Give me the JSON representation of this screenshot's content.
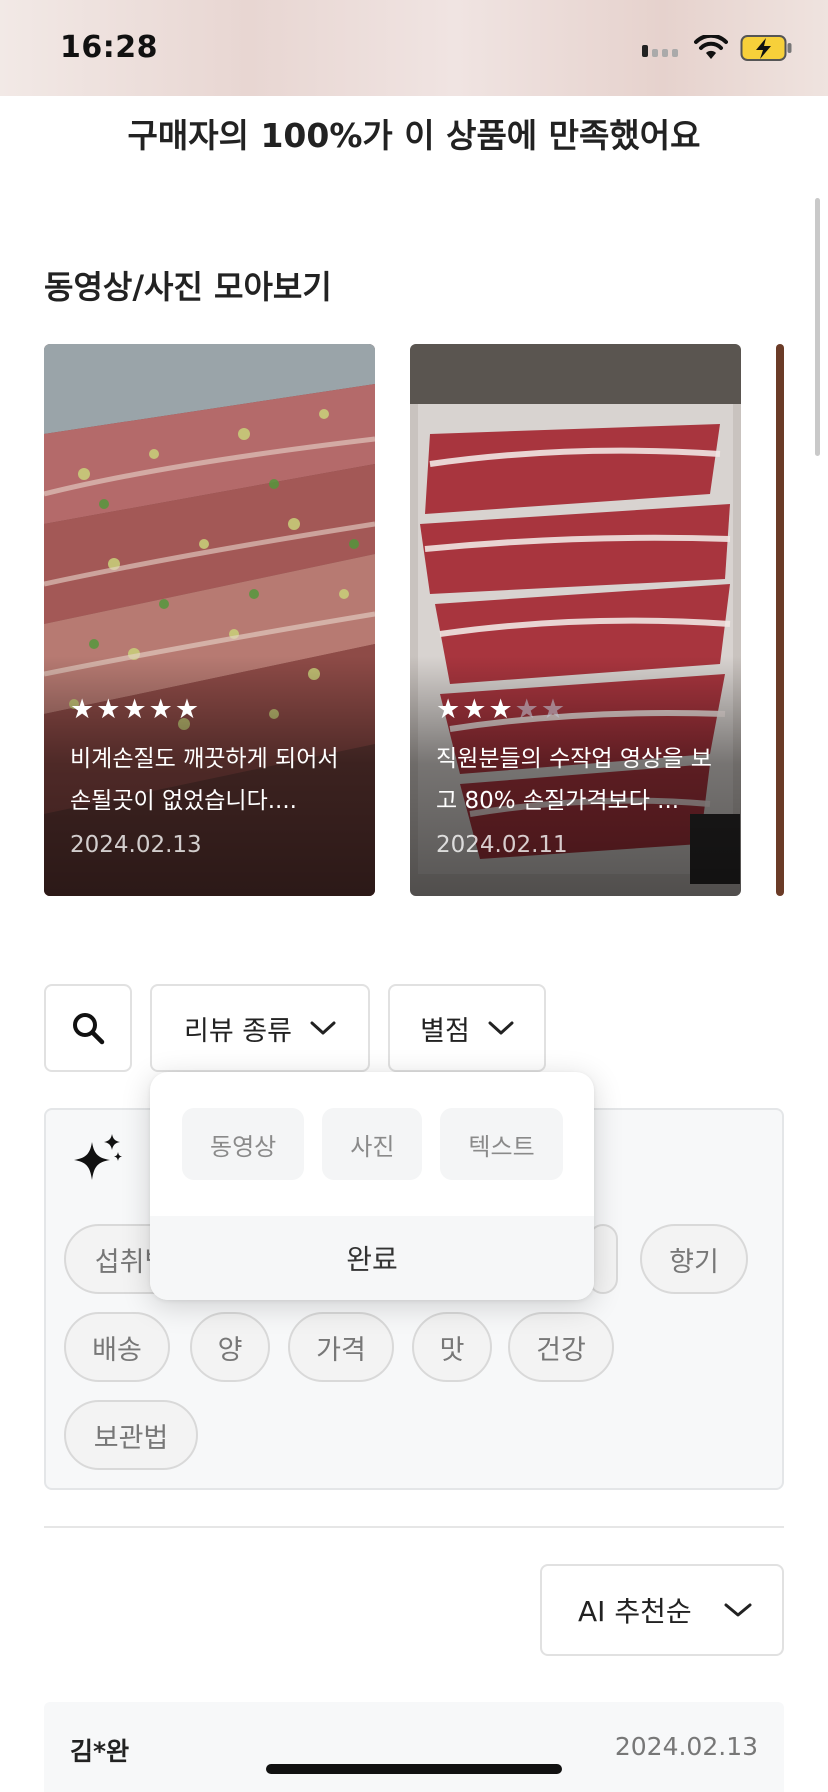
{
  "status_bar": {
    "time": "16:28"
  },
  "banner": {
    "text": "구매자의 100%가 이 상품에 만족했어요"
  },
  "gallery": {
    "title": "동영상/사진 모아보기",
    "cards": [
      {
        "rating": 5,
        "text": "비계손질도 깨끗하게 되어서 손될곳이 없었습니다....",
        "date": "2024.02.13"
      },
      {
        "rating": 3,
        "text": "직원분들의 수작업 영상을 보고 80% 손질가격보다 ...",
        "date": "2024.02.11"
      }
    ]
  },
  "filters": {
    "search_icon": "search-icon",
    "review_type_label": "리뷰 종류",
    "rating_label": "별점"
  },
  "review_type_popover": {
    "options": [
      "동영상",
      "사진",
      "텍스트"
    ],
    "done_label": "완료"
  },
  "keywords": {
    "icon": "sparkle-icon",
    "chips": [
      "섭취법",
      "향기",
      "배송",
      "양",
      "가격",
      "맛",
      "건강",
      "보관법"
    ]
  },
  "sort": {
    "label": "AI 추천순"
  },
  "first_review": {
    "author": "김*완",
    "date": "2024.02.13"
  },
  "colors": {
    "accent_text": "#222222",
    "muted_text": "#777777",
    "panel_bg": "#f7f8f9"
  }
}
